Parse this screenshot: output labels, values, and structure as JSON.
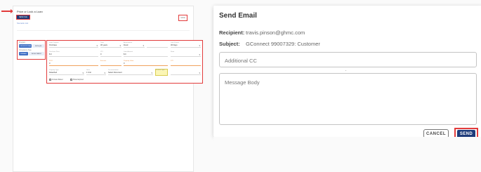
{
  "left_panel": {
    "title": "Price or Lock a Loan",
    "title_button": "NEW FILE",
    "sub_link": "Scenario List",
    "corner_button": "SAVE",
    "mini_section": {
      "label_top": "Program",
      "pill_1": "CONVENTIONAL",
      "pill_2": "NON-QM",
      "label_mid": "Occupancy Type",
      "pill_3": "PRIMARY",
      "pill_4": "INVESTMENT"
    },
    "form": {
      "row1": [
        {
          "label": "Loan Purpose",
          "value": "Purchase"
        },
        {
          "label": "Term",
          "value": "30 years"
        },
        {
          "label": "Amortization",
          "value": "Fixed"
        },
        {
          "label": "",
          "value": ""
        },
        {
          "label": "Lock Period",
          "value": "30 Days"
        }
      ],
      "row2": [
        {
          "label": "Purchase Price",
          "value": "$ 0"
        },
        {
          "label": "LTV",
          "value": "0"
        },
        {
          "label": "Loan Amount",
          "value": "$ 0"
        },
        {
          "label": "",
          "value": ""
        },
        {
          "label": "State",
          "value": ""
        }
      ],
      "row3": [
        {
          "label": "FICO",
          "value": "0"
        },
        {
          "label": "Escrows",
          "value": ""
        },
        {
          "label": "Property Value",
          "value": "0"
        },
        {
          "label": "",
          "value": ""
        },
        {
          "label": "DTI",
          "value": ""
        }
      ],
      "row4": [
        {
          "label": "Property Type",
          "value": "Detached"
        },
        {
          "label": "Units",
          "value": "1 Unit"
        },
        {
          "label": "Documentation",
          "value": "Select Document"
        },
        {
          "label": "Income Type",
          "value": ""
        }
      ],
      "check_1": "Include Waiver",
      "check_2": "Show Expired"
    }
  },
  "dialog": {
    "title": "Send Email",
    "recipient_label": "Recipient:",
    "recipient_value": "travis.pinson@ghmc.com",
    "subject_label": "Subject:",
    "subject_value": "GConnect 99007329: Customer",
    "cc_placeholder": "Additional CC",
    "body_placeholder": "Message Body",
    "cancel_label": "CANCEL",
    "send_label": "SEND"
  },
  "colors": {
    "highlight": "#e23b3b",
    "primary_button": "#1e3b7a",
    "accent_blue": "#3e6ec4"
  }
}
